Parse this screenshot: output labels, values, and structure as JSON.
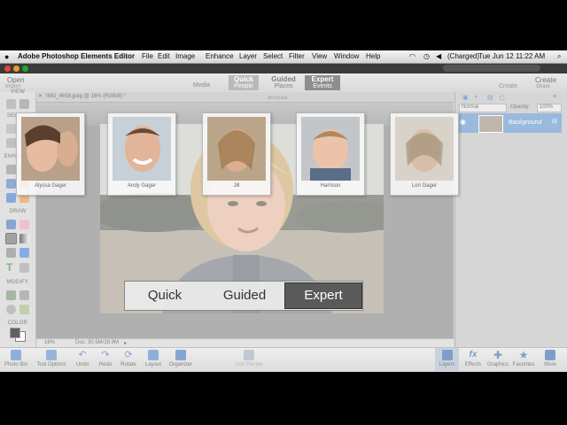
{
  "menubar": {
    "app_name": "Adobe Photoshop Elements Editor",
    "items": [
      "File",
      "Edit",
      "Image",
      "Enhance",
      "Layer",
      "Select",
      "Filter",
      "View",
      "Window",
      "Help"
    ],
    "battery": "(Charged)",
    "clock": "Tue Jun 12  11:22 AM"
  },
  "modebar": {
    "open_label": "Open",
    "create_label": "Create",
    "tabs": [
      {
        "top": "Quick",
        "bottom": "People"
      },
      {
        "top": "Guided",
        "bottom": "Places"
      },
      {
        "top": "Expert",
        "bottom": "Events"
      }
    ],
    "media_label": "Media",
    "import_label": "Import",
    "share_label": "Share"
  },
  "document_tab": "IMG_4658.jpeg @ 16% (RGB/8) *",
  "all_people_label": "All People",
  "toolbox": {
    "sections": [
      "VIEW",
      "SELECT",
      "ENHANCE",
      "DRAW",
      "MODIFY",
      "COLOR"
    ]
  },
  "people": [
    {
      "name": "Alyssa Gager"
    },
    {
      "name": "Andy Gager"
    },
    {
      "name": "Jill"
    },
    {
      "name": "Harrison"
    },
    {
      "name": "Lori Gager"
    }
  ],
  "status": {
    "zoom": "16%",
    "doc": "Doc: 30.5M/28.9M"
  },
  "layers": {
    "blend_mode": "Normal",
    "opacity_label": "Opacity:",
    "opacity_value": "100%",
    "layer_name": "Background"
  },
  "bottom_left": [
    "Photo Bin",
    "Tool Options",
    "Undo",
    "Redo",
    "Rotate",
    "Layout",
    "Organizer"
  ],
  "bottom_center": "Add People",
  "bottom_right": [
    "Layers",
    "Effects",
    "Graphics",
    "Favorites",
    "More"
  ],
  "switcher": [
    "Quick",
    "Guided",
    "Expert"
  ],
  "colors": {
    "accent": "#5b8fc9",
    "switch_active": "#5a5a5a"
  }
}
